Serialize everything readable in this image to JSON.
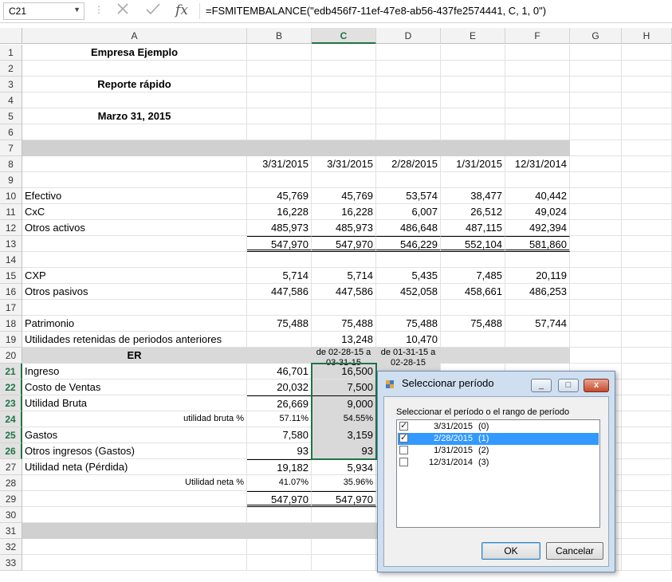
{
  "formula_bar": {
    "name_box": "C21",
    "formula": "=FSMITEMBALANCE(\"edb456f7-11ef-47e8-ab56-437fe2574441, C, 1, 0\")",
    "cancel_icon": "x-icon",
    "enter_icon": "check-icon",
    "fx_label": "fx"
  },
  "columns": [
    "A",
    "B",
    "C",
    "D",
    "E",
    "F",
    "G",
    "H"
  ],
  "rows": [
    "1",
    "2",
    "3",
    "4",
    "5",
    "6",
    "7",
    "8",
    "9",
    "10",
    "11",
    "12",
    "13",
    "14",
    "15",
    "16",
    "17",
    "18",
    "19",
    "20",
    "21",
    "22",
    "23",
    "24",
    "25",
    "26",
    "27",
    "28",
    "29",
    "30",
    "31",
    "32",
    "33"
  ],
  "cells": {
    "A1": "Empresa Ejemplo",
    "A3": "Reporte rápido",
    "A5": "Marzo 31, 2015",
    "B8": "3/31/2015",
    "C8": "3/31/2015",
    "D8": "2/28/2015",
    "E8": "1/31/2015",
    "F8": "12/31/2014",
    "A10": "Efectivo",
    "B10": "45,769",
    "C10": "45,769",
    "D10": "53,574",
    "E10": "38,477",
    "F10": "40,442",
    "A11": "CxC",
    "B11": "16,228",
    "C11": "16,228",
    "D11": "6,007",
    "E11": "26,512",
    "F11": "49,024",
    "A12": "Otros activos",
    "B12": "485,973",
    "C12": "485,973",
    "D12": "486,648",
    "E12": "487,115",
    "F12": "492,394",
    "B13": "547,970",
    "C13": "547,970",
    "D13": "546,229",
    "E13": "552,104",
    "F13": "581,860",
    "A15": "CXP",
    "B15": "5,714",
    "C15": "5,714",
    "D15": "5,435",
    "E15": "7,485",
    "F15": "20,119",
    "A16": "Otros pasivos",
    "B16": "447,586",
    "C16": "447,586",
    "D16": "452,058",
    "E16": "458,661",
    "F16": "486,253",
    "A18": "Patrimonio",
    "B18": "75,488",
    "C18": "75,488",
    "D18": "75,488",
    "E18": "75,488",
    "F18": "57,744",
    "A19": "Utilidades retenidas de periodos anteriores",
    "C19": "13,248",
    "D19": "10,470",
    "A20": "ER",
    "C20": "de 02-28-15 a 03-31-15",
    "D20": "de 01-31-15 a 02-28-15",
    "A21": "Ingreso",
    "B21": "46,701",
    "C21": "16,500",
    "A22": "Costo de Ventas",
    "B22": "20,032",
    "C22": "7,500",
    "A23": "Utilidad Bruta",
    "B23": "26,669",
    "C23": "9,000",
    "A24": "utilidad bruta %",
    "B24": "57.11%",
    "C24": "54.55%",
    "A25": "Gastos",
    "B25": "7,580",
    "C25": "3,159",
    "A26": "Otros ingresos (Gastos)",
    "B26": "93",
    "C26": "93",
    "A27": "Utilidad neta (Pérdida)",
    "B27": "19,182",
    "C27": "5,934",
    "A28": "Utilidad neta %",
    "B28": "41.07%",
    "C28": "35.96%",
    "B29": "547,970",
    "C29": "547,970"
  },
  "dialog": {
    "title": "Seleccionar período",
    "title_icon": "app-icon",
    "prompt": "Seleccionar el período o el rango de período",
    "items": [
      {
        "label": "3/31/2015",
        "index": "(0)",
        "checked": true,
        "highlighted": false
      },
      {
        "label": "2/28/2015",
        "index": "(1)",
        "checked": true,
        "highlighted": true
      },
      {
        "label": "1/31/2015",
        "index": "(2)",
        "checked": false,
        "highlighted": false
      },
      {
        "label": "12/31/2014",
        "index": "(3)",
        "checked": false,
        "highlighted": false
      }
    ],
    "ok_label": "OK",
    "cancel_label": "Cancelar",
    "minimize_label": "_",
    "maximize_label": "□",
    "close_label": "x"
  },
  "colors": {
    "selection": "#217346",
    "band": "#d0d0d0",
    "highlight": "#3399ff"
  }
}
